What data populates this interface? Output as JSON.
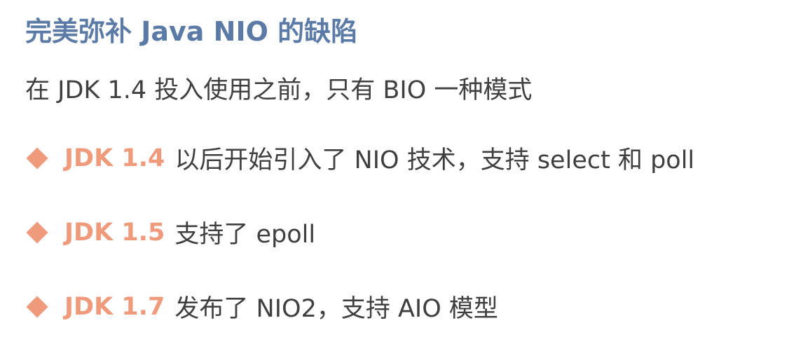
{
  "title": "完美弥补 Java NIO 的缺陷",
  "intro": "在 JDK 1.4 投入使用之前，只有 BIO 一种模式",
  "bullets": [
    {
      "version": "JDK 1.4",
      "text": "以后开始引入了 NIO 技术，支持 select 和 poll"
    },
    {
      "version": "JDK 1.5",
      "text": "支持了 epoll"
    },
    {
      "version": "JDK 1.7",
      "text": "发布了 NIO2，支持 AIO 模型"
    }
  ],
  "colors": {
    "title": "#5b7ba6",
    "accent": "#f09a7c",
    "body_text": "#3f3f3f"
  },
  "icons": {
    "bullet": "diamond-icon"
  }
}
